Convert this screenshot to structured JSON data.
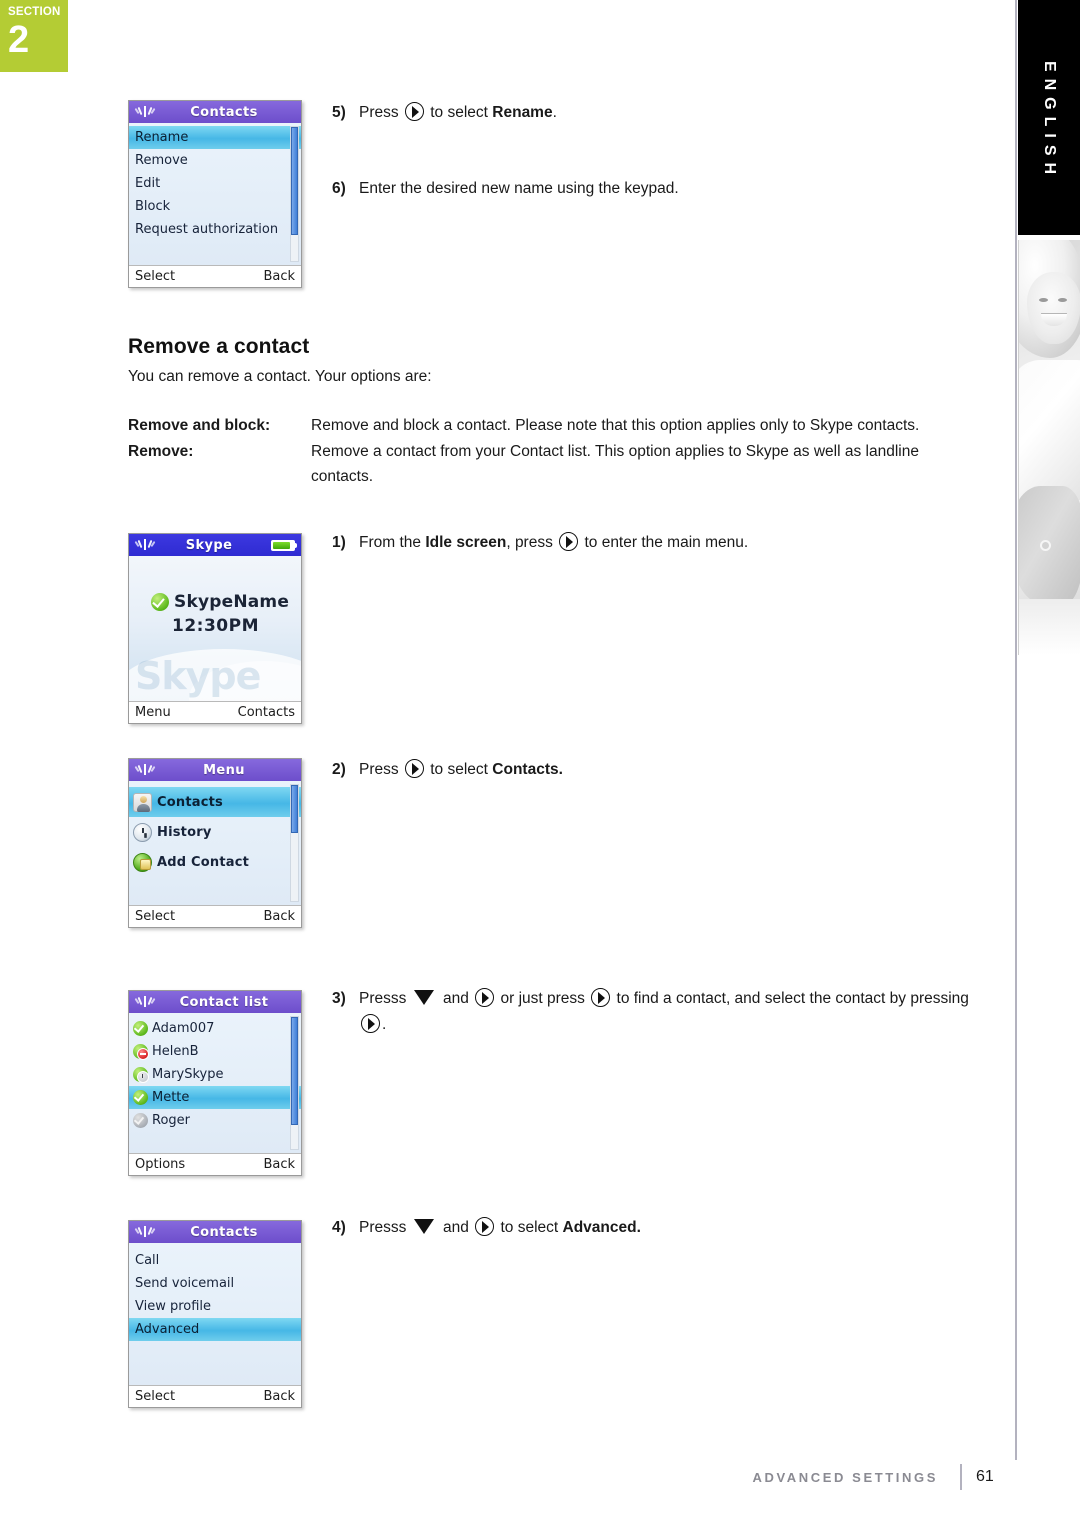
{
  "section_badge": {
    "word": "SECTION",
    "number": "2"
  },
  "language_tab": {
    "label": "ENGLISH"
  },
  "steps_top": [
    {
      "num": "5)",
      "pre": "Press ",
      "icon": "nav-right-icon",
      "mid": " to select ",
      "bold": "Rename",
      "post": "."
    },
    {
      "num": "6)",
      "pre": "Enter the desired new name using the keypad.",
      "icon": "",
      "mid": "",
      "bold": "",
      "post": ""
    }
  ],
  "heading": "Remove a contact",
  "intro": "You can remove a contact. Your options are:",
  "options": [
    {
      "term": "Remove and block:",
      "definition": "Remove and block a contact. Please note that this option applies only to Skype contacts."
    },
    {
      "term": "Remove:",
      "definition": "Remove a contact from your Contact list. This option applies to Skype as well as landline contacts."
    }
  ],
  "steps": {
    "s1": {
      "num": "1)",
      "a": "From the ",
      "b1": "Idle screen",
      "c": ", press ",
      "d": " to enter the main menu."
    },
    "s2": {
      "num": "2)",
      "a": "Press ",
      "c": " to select ",
      "b1": "Contacts."
    },
    "s3": {
      "num": "3)",
      "a": "Presss ",
      "b": " and ",
      "c": " or just press ",
      "d": " to find a contact, and select the contact by pressing ",
      "e": "."
    },
    "s4": {
      "num": "4)",
      "a": "Presss ",
      "b": " and ",
      "c": " to select ",
      "b1": "Advanced."
    }
  },
  "phones": {
    "contacts_options": {
      "title": "Contacts",
      "items": [
        "Rename",
        "Remove",
        "Edit",
        "Block",
        "Request authorization"
      ],
      "selected_index": 0,
      "softkey_left": "Select",
      "softkey_right": "Back"
    },
    "idle": {
      "title": "Skype",
      "user": "SkypeName",
      "time": "12:30PM",
      "watermark": "Skype",
      "softkey_left": "Menu",
      "softkey_right": "Contacts"
    },
    "menu": {
      "title": "Menu",
      "items": [
        {
          "label": "Contacts",
          "icon": "contacts-icon"
        },
        {
          "label": "History",
          "icon": "history-icon"
        },
        {
          "label": "Add Contact",
          "icon": "add-contact-icon"
        }
      ],
      "selected_index": 0,
      "softkey_left": "Select",
      "softkey_right": "Back"
    },
    "contact_list": {
      "title": "Contact list",
      "items": [
        {
          "name": "Adam007",
          "status": "online"
        },
        {
          "name": "HelenB",
          "status": "blocked"
        },
        {
          "name": "MarySkype",
          "status": "away"
        },
        {
          "name": "Mette",
          "status": "online"
        },
        {
          "name": "Roger",
          "status": "offline"
        }
      ],
      "selected_index": 3,
      "softkey_left": "Options",
      "softkey_right": "Back"
    },
    "contacts_menu": {
      "title": "Contacts",
      "items": [
        "Call",
        "Send voicemail",
        "View profile",
        "Advanced"
      ],
      "selected_index": 3,
      "softkey_left": "Select",
      "softkey_right": "Back"
    }
  },
  "footer": {
    "label": "ADVANCED SETTINGS",
    "page": "61"
  },
  "colors": {
    "badge_green": "#b4cc34",
    "header_purple": "#7a5fd6",
    "header_blue": "#3330d8",
    "highlight_cyan": "#46b7e6"
  }
}
